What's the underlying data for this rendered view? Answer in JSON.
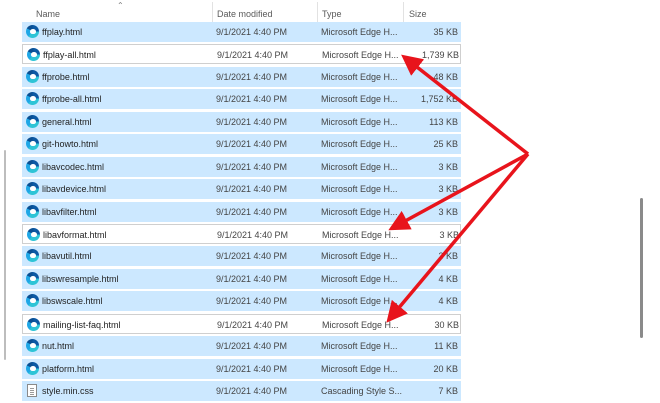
{
  "columns": {
    "name": "Name",
    "date": "Date modified",
    "type": "Type",
    "size": "Size"
  },
  "files": [
    {
      "name": "ffplay.html",
      "date": "9/1/2021 4:40 PM",
      "type": "Microsoft Edge H...",
      "size": "35 KB",
      "icon": "edge-html-icon",
      "selected": true
    },
    {
      "name": "ffplay-all.html",
      "date": "9/1/2021 4:40 PM",
      "type": "Microsoft Edge H...",
      "size": "1,739 KB",
      "icon": "edge-html-icon",
      "selected": false
    },
    {
      "name": "ffprobe.html",
      "date": "9/1/2021 4:40 PM",
      "type": "Microsoft Edge H...",
      "size": "48 KB",
      "icon": "edge-html-icon",
      "selected": true
    },
    {
      "name": "ffprobe-all.html",
      "date": "9/1/2021 4:40 PM",
      "type": "Microsoft Edge H...",
      "size": "1,752 KB",
      "icon": "edge-html-icon",
      "selected": true
    },
    {
      "name": "general.html",
      "date": "9/1/2021 4:40 PM",
      "type": "Microsoft Edge H...",
      "size": "113 KB",
      "icon": "edge-html-icon",
      "selected": true
    },
    {
      "name": "git-howto.html",
      "date": "9/1/2021 4:40 PM",
      "type": "Microsoft Edge H...",
      "size": "25 KB",
      "icon": "edge-html-icon",
      "selected": true
    },
    {
      "name": "libavcodec.html",
      "date": "9/1/2021 4:40 PM",
      "type": "Microsoft Edge H...",
      "size": "3 KB",
      "icon": "edge-html-icon",
      "selected": true
    },
    {
      "name": "libavdevice.html",
      "date": "9/1/2021 4:40 PM",
      "type": "Microsoft Edge H...",
      "size": "3 KB",
      "icon": "edge-html-icon",
      "selected": true
    },
    {
      "name": "libavfilter.html",
      "date": "9/1/2021 4:40 PM",
      "type": "Microsoft Edge H...",
      "size": "3 KB",
      "icon": "edge-html-icon",
      "selected": true
    },
    {
      "name": "libavformat.html",
      "date": "9/1/2021 4:40 PM",
      "type": "Microsoft Edge H...",
      "size": "3 KB",
      "icon": "edge-html-icon",
      "selected": false
    },
    {
      "name": "libavutil.html",
      "date": "9/1/2021 4:40 PM",
      "type": "Microsoft Edge H...",
      "size": "3 KB",
      "icon": "edge-html-icon",
      "selected": true
    },
    {
      "name": "libswresample.html",
      "date": "9/1/2021 4:40 PM",
      "type": "Microsoft Edge H...",
      "size": "4 KB",
      "icon": "edge-html-icon",
      "selected": true
    },
    {
      "name": "libswscale.html",
      "date": "9/1/2021 4:40 PM",
      "type": "Microsoft Edge H...",
      "size": "4 KB",
      "icon": "edge-html-icon",
      "selected": true
    },
    {
      "name": "mailing-list-faq.html",
      "date": "9/1/2021 4:40 PM",
      "type": "Microsoft Edge H...",
      "size": "30 KB",
      "icon": "edge-html-icon",
      "selected": false
    },
    {
      "name": "nut.html",
      "date": "9/1/2021 4:40 PM",
      "type": "Microsoft Edge H...",
      "size": "11 KB",
      "icon": "edge-html-icon",
      "selected": true
    },
    {
      "name": "platform.html",
      "date": "9/1/2021 4:40 PM",
      "type": "Microsoft Edge H...",
      "size": "20 KB",
      "icon": "edge-html-icon",
      "selected": true
    },
    {
      "name": "style.min.css",
      "date": "9/1/2021 4:40 PM",
      "type": "Cascading Style S...",
      "size": "7 KB",
      "icon": "css-file-icon",
      "selected": true
    }
  ],
  "colors": {
    "selection": "#cce8ff",
    "annotation_arrow": "#e8141c"
  }
}
